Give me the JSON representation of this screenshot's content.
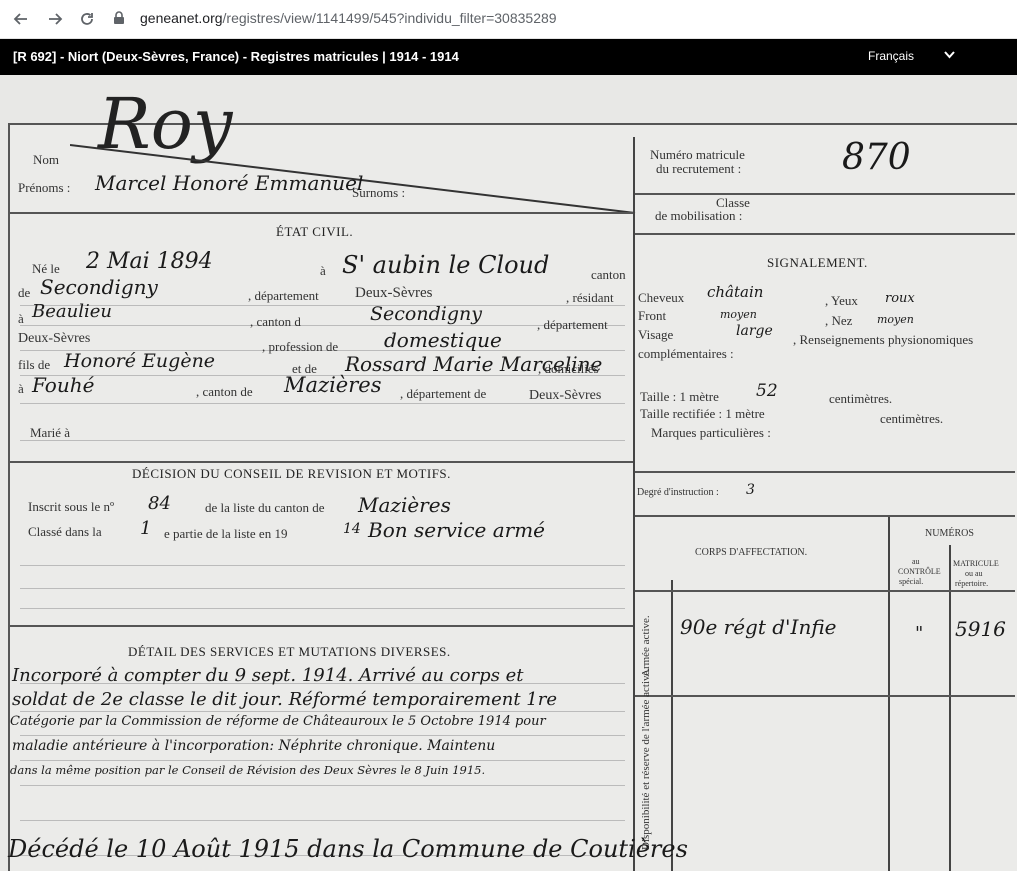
{
  "browser": {
    "url_domain": "geneanet.org",
    "url_path": "/registres/view/1141499/545?individu_filter=30835289"
  },
  "header": {
    "title": "[R 692] - Niort (Deux-Sèvres, France) - Registres matricules | 1914 - 1914",
    "language": "Français"
  },
  "icons": {
    "back": "arrow-left-icon",
    "forward": "arrow-right-icon",
    "reload": "reload-icon",
    "lock": "lock-icon",
    "dropdown": "chevron-down-icon"
  },
  "document": {
    "printed": {
      "nom": "Nom",
      "prenoms": "Prénoms :",
      "surnoms": "Surnoms :",
      "etat_civil": "ÉTAT CIVIL.",
      "ne_le": "Né le",
      "a": "à",
      "canton": "canton",
      "de": "de",
      "departement": ", département",
      "residant": ", résidant",
      "canton_de": ", canton d",
      "departement2": ", département",
      "profession_de": ", profession de",
      "fils_de": "fils de",
      "et_de": "et de",
      "domicilies": ", domiciliés",
      "canton_de2": ", canton de",
      "departement3": ", département de",
      "marie_a": "Marié à",
      "decision": "DÉCISION DU CONSEIL DE REVISION ET MOTIFS.",
      "inscrit": "Inscrit sous le nº",
      "de_la_liste": "de la liste du canton de",
      "classe_dans": "Classé dans la",
      "partie": "e partie de la liste en 19",
      "detail": "DÉTAIL DES SERVICES ET MUTATIONS DIVERSES.",
      "numero_matricule": "Numéro matricule",
      "du_recrutement": "du recrutement :",
      "classe": "Classe",
      "de_mobilisation": "de mobilisation :",
      "signalement": "SIGNALEMENT.",
      "cheveux": "Cheveux",
      "yeux": ", Yeux",
      "front": "Front",
      "nez": ", Nez",
      "visage": "Visage",
      "renseignements": ", Renseignements physionomiques",
      "complementaires": "complémentaires :",
      "taille": "Taille : 1 mètre",
      "centimetres": "centimètres.",
      "taille_rectifiee": "Taille rectifiée : 1 mètre",
      "centimetres2": "centimètres.",
      "marques": "Marques particulières :",
      "degre": "Degré d'instruction :",
      "corps": "CORPS D'AFFECTATION.",
      "numeros": "NUMÉROS",
      "au_controle": "au",
      "controle2": "CONTRÔLE",
      "special": "spécial.",
      "matricule_col": "MATRICULE",
      "ou_au": "ou au",
      "repertoire": "répertoire.",
      "armee_active": "Armée active.",
      "disponibilite": "Disponibilité et réserve de l'armée active."
    },
    "handwritten": {
      "nom": "Roy",
      "prenoms": "Marcel Honoré Emmanuel",
      "matricule": "870",
      "date_naissance": "2 Mai 1894",
      "lieu_naissance": "S' aubin le Cloud",
      "canton_naissance": "Secondigny",
      "departement_naissance": "Deux-Sèvres",
      "residence": "Beaulieu",
      "canton_residence": "Secondigny",
      "departement_residence": "Deux-Sèvres",
      "profession": "domestique",
      "pere": "Honoré Eugène",
      "mere": "Rossard Marie Marceline",
      "domicile": "Fouhé",
      "canton_domicile": "Mazières",
      "departement_domicile": "Deux-Sèvres",
      "inscrit_numero": "84",
      "canton_liste": "Mazières",
      "classe_partie": "1",
      "annee": "14",
      "decision": "Bon service armé",
      "cheveux": "châtain",
      "yeux": "roux",
      "front": "moyen",
      "nez": "moyen",
      "visage": "large",
      "taille": "52",
      "degre": "3",
      "corps": "90e régt d'Infie",
      "controle": "\"",
      "matricule_corps": "5916",
      "detail_1": "Incorporé à compter du 9 sept. 1914. Arrivé au corps et",
      "detail_2": "soldat de 2e classe le dit jour. Réformé temporairement 1re",
      "detail_3": "Catégorie par la Commission de réforme de Châteauroux le 5 Octobre 1914 pour",
      "detail_4": "maladie antérieure à l'incorporation: Néphrite chronique. Maintenu",
      "detail_5": "dans la même position par le Conseil de Révision des Deux Sèvres le 8 Juin 1915.",
      "deces": "Décédé le 10 Août 1915 dans la Commune de Coutières"
    }
  }
}
